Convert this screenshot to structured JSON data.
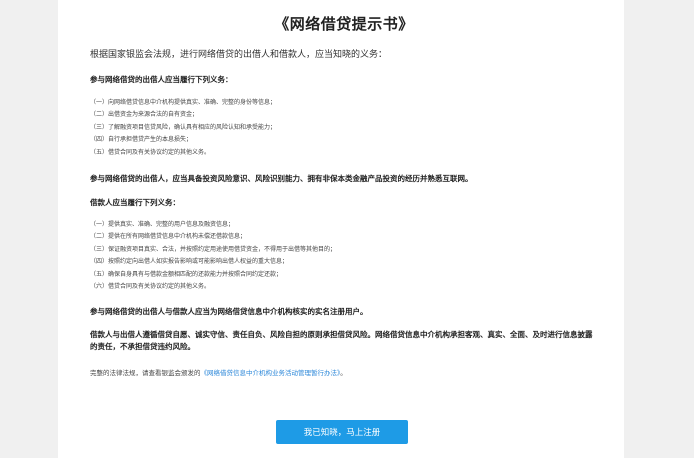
{
  "title": "《网络借贷提示书》",
  "intro": "根据国家银监会法规，进行网络借贷的出借人和借款人，应当知晓的义务：",
  "lender": {
    "heading": "参与网络借贷的出借人应当履行下列义务：",
    "items": [
      "（一）向网络借贷信息中介机构提供真实、准确、完整的身份等信息；",
      "（二）出借资金为来源合法的自有资金；",
      "（三）了解融资项目信贷风险，确认具有相应的风险认知和承受能力；",
      "（四）自行承担借贷产生的本息损失；",
      "（五）借贷合同及有关协议约定的其他义务。"
    ]
  },
  "risk_statement": "参与网络借贷的出借人，应当具备投资风险意识、风险识别能力、拥有非保本类金融产品投资的经历并熟悉互联网。",
  "borrower": {
    "heading": "借款人应当履行下列义务：",
    "items": [
      "（一）提供真实、准确、完整的用户信息及融资信息；",
      "（二）提供在所有网络借贷信息中介机构未偿还借款信息；",
      "（三）保证融资项目真实、合法，并按照约定用途使用借贷资金，不得用于出借等其他目的；",
      "（四）按照约定向出借人如实报告影响或可能影响出借人权益的重大信息；",
      "（五）确保自身具有与借款金额相匹配的还款能力并按照合同约定还款；",
      "（六）借贷合同及有关协议约定的其他义务。"
    ]
  },
  "realname_notice": "参与网络借贷的出借人与借款人应当为网络借贷信息中介机构核实的实名注册用户。",
  "duty_statement": "借款人与出借人遵循借贷自愿、诚实守信、责任自负、风险自担的原则承担借贷风险。网络借贷信息中介机构承担客观、真实、全面、及时进行信息披露的责任，不承担借贷违约风险。",
  "law": {
    "prefix": "完整的法律法规，请查看银监会颁发的",
    "link": "《网络借贷信息中介机构业务活动管理暂行办法》",
    "suffix": "。"
  },
  "button_label": "我已知晓，马上注册",
  "colors": {
    "accent": "#1e9be6",
    "link": "#2b87d9",
    "background": "#f0f0f0"
  }
}
